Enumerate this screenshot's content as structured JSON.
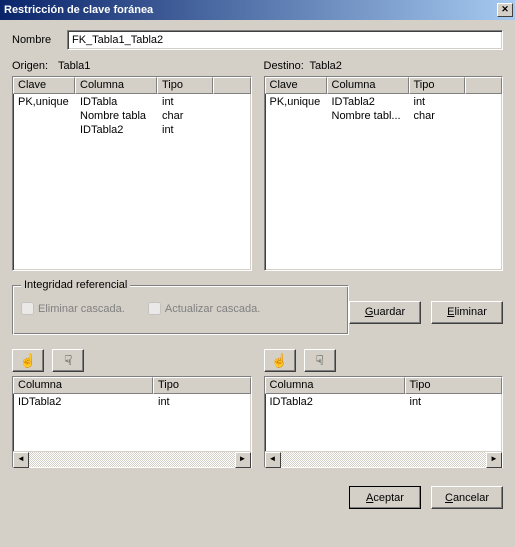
{
  "window": {
    "title": "Restricción de clave foránea",
    "close_glyph": "✕"
  },
  "name_row": {
    "label": "Nombre",
    "value": "FK_Tabla1_Tabla2"
  },
  "origin": {
    "label": "Origen:",
    "value": "Tabla1"
  },
  "dest": {
    "label": "Destino:",
    "value": "Tabla2"
  },
  "list_headers": {
    "clave": "Clave",
    "columna": "Columna",
    "tipo": "Tipo"
  },
  "origin_rows": [
    {
      "clave": "PK,unique",
      "columna": "IDTabla",
      "tipo": "int"
    },
    {
      "clave": "",
      "columna": "Nombre tabla",
      "tipo": "char"
    },
    {
      "clave": "",
      "columna": "IDTabla2",
      "tipo": "int"
    }
  ],
  "dest_rows": [
    {
      "clave": "PK,unique",
      "columna": "IDTabla2",
      "tipo": "int"
    },
    {
      "clave": "",
      "columna": "Nombre tabl...",
      "tipo": "char"
    }
  ],
  "integrity": {
    "legend": "Integridad referencial",
    "delete": "Eliminar cascada.",
    "update": "Actualizar cascada."
  },
  "buttons": {
    "save": "Guardar",
    "delete": "Eliminar",
    "accept": "Aceptar",
    "cancel": "Cancelar"
  },
  "bottom_headers": {
    "columna": "Columna",
    "tipo": "Tipo"
  },
  "bottom_left_rows": [
    {
      "columna": "IDTabla2",
      "tipo": "int"
    }
  ],
  "bottom_right_rows": [
    {
      "columna": "IDTabla2",
      "tipo": "int"
    }
  ],
  "icons": {
    "hand_point": "☝",
    "hand_down": "☟",
    "left": "◄",
    "right": "►"
  },
  "underline": {
    "g": "G",
    "e": "E",
    "a": "A",
    "c": "C"
  }
}
